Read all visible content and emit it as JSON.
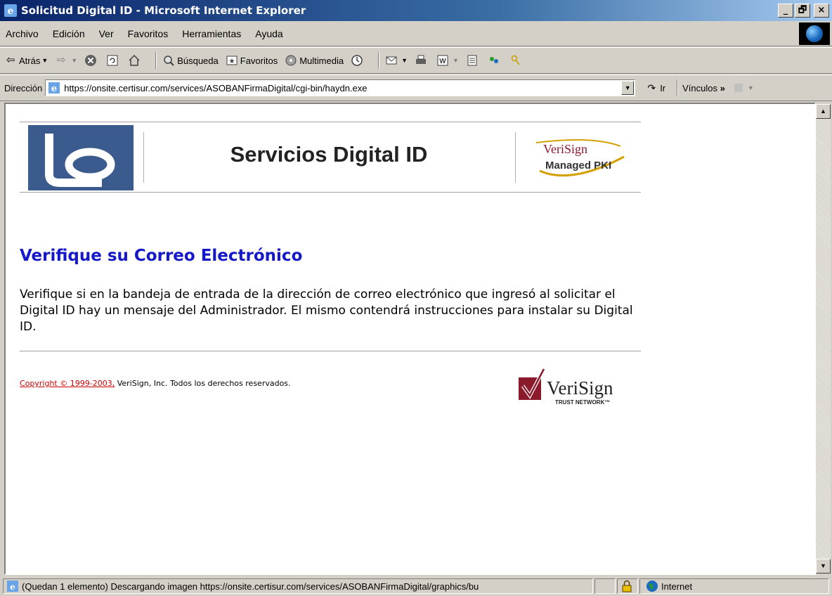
{
  "window": {
    "title": "Solicitud Digital ID - Microsoft Internet Explorer",
    "minimize": "_",
    "maximize": "🗗",
    "close": "×"
  },
  "menu": {
    "items": [
      "Archivo",
      "Edición",
      "Ver",
      "Favoritos",
      "Herramientas",
      "Ayuda"
    ]
  },
  "toolbar": {
    "back": "Atrás",
    "search": "Búsqueda",
    "favorites": "Favoritos",
    "media": "Multimedia"
  },
  "address": {
    "label": "Dirección",
    "url": "https://onsite.certisur.com/services/ASOBANFirmaDigital/cgi-bin/haydn.exe",
    "go": "Ir",
    "links": "Vínculos"
  },
  "page": {
    "header_title": "Servicios Digital ID",
    "pki_logo_line1": "VeriSign",
    "pki_logo_line2": "Managed PKI",
    "heading": "Verifique su Correo Electrónico",
    "body": "Verifique si en la bandeja de entrada de la dirección de correo electrónico que ingresó al solicitar el Digital ID hay un mensaje del Administrador. El mismo contendrá instrucciones para instalar su Digital ID.",
    "copyright_link": "Copyright © 1999-2003,",
    "copyright_rest": " VeriSign, Inc. Todos los derechos reservados.",
    "tn_logo_name": "VeriSign",
    "tn_logo_sub": "TRUST NETWORK™"
  },
  "status": {
    "message": "(Quedan 1 elemento) Descargando imagen https://onsite.certisur.com/services/ASOBANFirmaDigital/graphics/bu",
    "zone": "Internet"
  },
  "colors": {
    "heading": "#1418c8",
    "link": "#cc0000",
    "logo_blue": "#3b5b8e",
    "verisign_red": "#8b1a2b"
  }
}
